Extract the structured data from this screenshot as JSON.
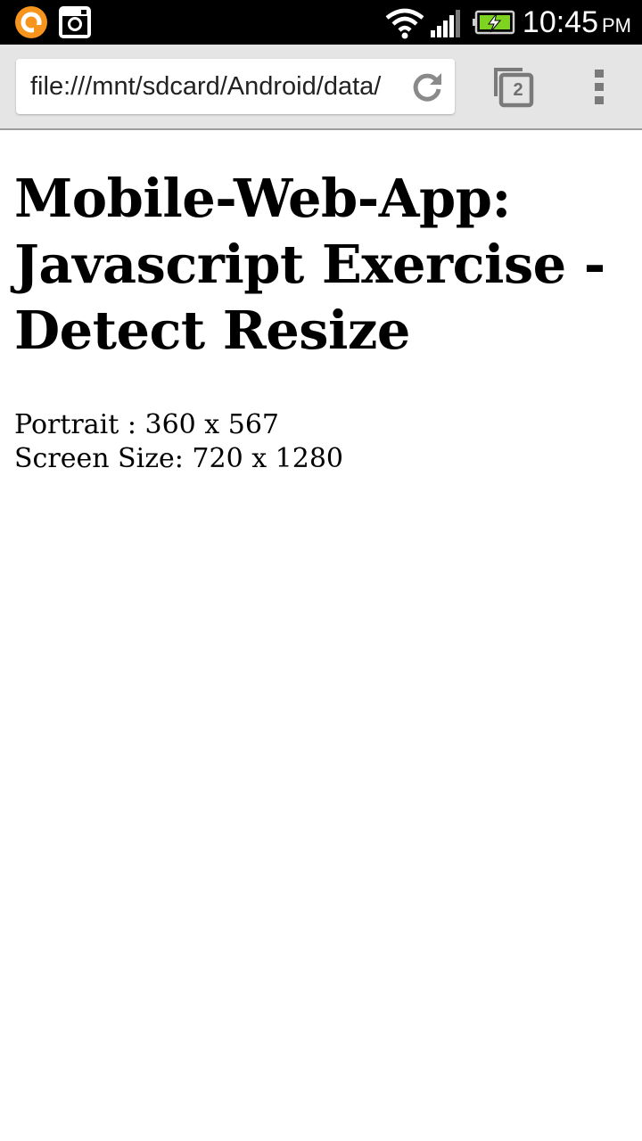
{
  "status_bar": {
    "notifications": [
      "app-notification-icon",
      "instagram-icon"
    ],
    "icons": [
      "wifi-icon",
      "signal-icon",
      "battery-charging-icon"
    ],
    "time": "10:45",
    "ampm": "PM",
    "colors": {
      "background": "#000000",
      "battery_fill": "#7ed321",
      "notification_orange": "#f7941d"
    }
  },
  "browser": {
    "url": "file:///mnt/sdcard/Android/data/",
    "tab_count": "2",
    "icons": {
      "reload": "reload-icon",
      "tabs": "tabs-icon",
      "menu": "overflow-menu-icon"
    }
  },
  "page": {
    "title": "Mobile-Web-App: Javascript Exercise - Detect Resize",
    "orientation_line": "Portrait : 360 x 567",
    "screen_size_line": "Screen Size: 720 x 1280"
  }
}
